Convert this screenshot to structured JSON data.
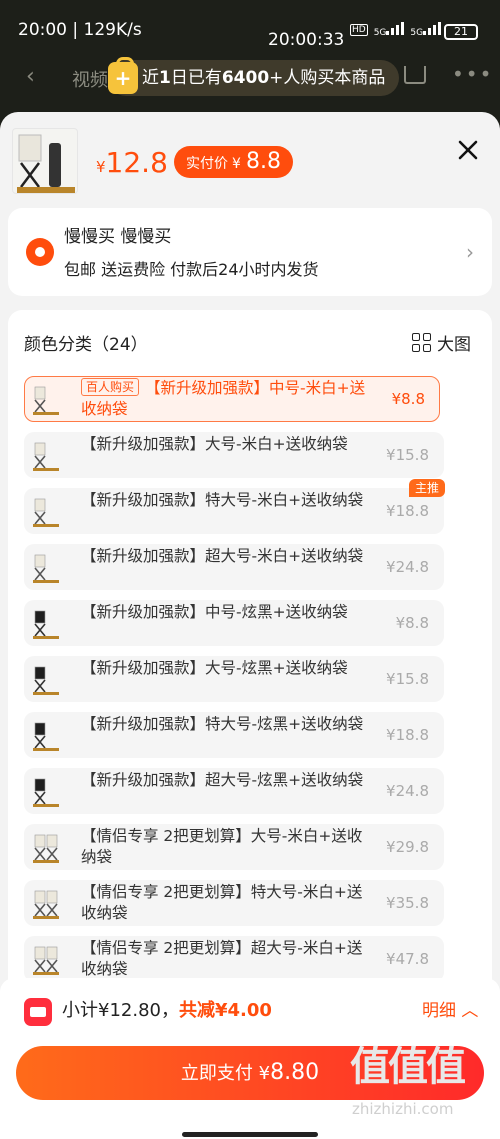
{
  "status_bar": {
    "left": "20:00 | 129K/s",
    "clock": "20:00:33",
    "hd": "HD",
    "net1": "5G",
    "net2": "5G",
    "battery": "21"
  },
  "background_nav": {
    "back_icon": "chevron-left-icon",
    "title": "视频",
    "cart_icon": "cart-icon",
    "more_icon": "more-icon"
  },
  "banner": {
    "prefix": "近",
    "days": "1",
    "middle": "日已有",
    "count": "6400",
    "suffix": "+人购买本商品"
  },
  "product": {
    "currency": "¥",
    "price": "12.8",
    "pay_label": "实付价",
    "pay_currency": "¥",
    "pay_price": "8.8"
  },
  "shipping": {
    "name": "慢慢买 慢慢买",
    "info": "包邮 送运费险 付款后24小时内发货"
  },
  "sku": {
    "title": "颜色分类（24）",
    "big_view": "大图",
    "options": [
      {
        "tag": "百人购买",
        "label": "【新升级加强款】中号-米白+送收纳袋",
        "price": "¥8.8",
        "color": "white",
        "selected": true
      },
      {
        "label": "【新升级加强款】大号-米白+送收纳袋",
        "price": "¥15.8",
        "color": "white"
      },
      {
        "label": "【新升级加强款】特大号-米白+送收纳袋",
        "price": "¥18.8",
        "color": "white",
        "badge": "主推"
      },
      {
        "label": "【新升级加强款】超大号-米白+送收纳袋",
        "price": "¥24.8",
        "color": "white"
      },
      {
        "label": "【新升级加强款】中号-炫黑+送收纳袋",
        "price": "¥8.8",
        "color": "black"
      },
      {
        "label": "【新升级加强款】大号-炫黑+送收纳袋",
        "price": "¥15.8",
        "color": "black"
      },
      {
        "label": "【新升级加强款】特大号-炫黑+送收纳袋",
        "price": "¥18.8",
        "color": "black"
      },
      {
        "label": "【新升级加强款】超大号-炫黑+送收纳袋",
        "price": "¥24.8",
        "color": "black"
      },
      {
        "label": "【情侣专享 2把更划算】大号-米白+送收纳袋",
        "price": "¥29.8",
        "color": "pair"
      },
      {
        "label": "【情侣专享 2把更划算】特大号-米白+送收纳袋",
        "price": "¥35.8",
        "color": "pair"
      },
      {
        "label": "【情侣专享 2把更划算】超大号-米白+送收纳袋",
        "price": "¥47.8",
        "color": "pair"
      }
    ]
  },
  "footer": {
    "subtotal": "小计¥12.80，",
    "saving": "共减¥4.00",
    "detail": "明细 ︿",
    "pay_label": "立即支付 ¥",
    "pay_amount": "8.80",
    "watermark": "值值值",
    "watermark_url": "zhizhizhi.com"
  },
  "colors": {
    "accent": "#ff4d0d",
    "selected_bg": "#fff2ec",
    "option_bg": "#f5f5f5",
    "banner_bg": "#3f3a2b"
  }
}
